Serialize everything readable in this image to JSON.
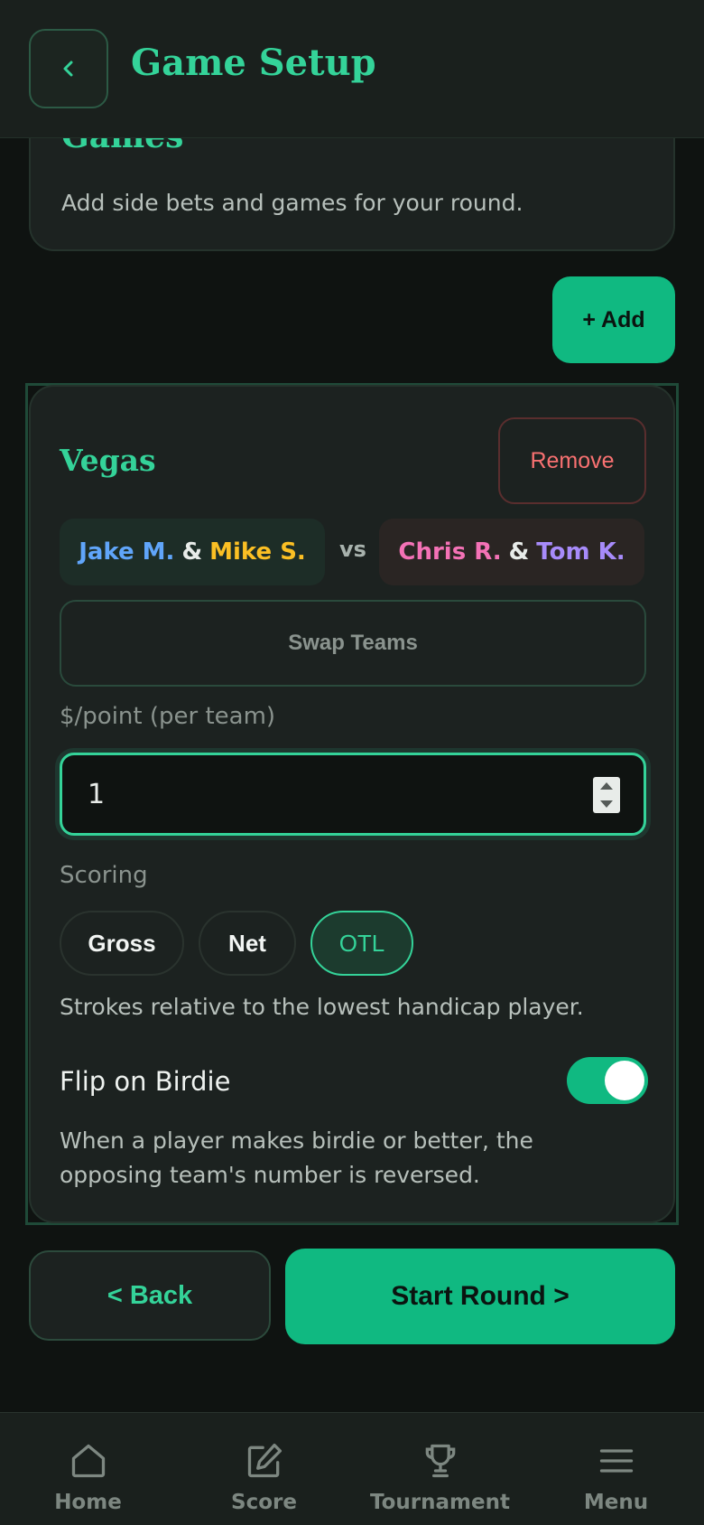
{
  "header": {
    "title": "Game Setup",
    "back_icon": "chevron-left-icon"
  },
  "games_card": {
    "title": "Games",
    "description": "Add side bets and games for your round."
  },
  "add_button": {
    "label": "+ Add"
  },
  "vegas": {
    "title": "Vegas",
    "remove_label": "Remove",
    "team_a": {
      "player1": "Jake M.",
      "player1_color": "#60a5fa",
      "joiner": "&",
      "player2": "Mike S.",
      "player2_color": "#fbbf24"
    },
    "vs_label": "vs",
    "team_b": {
      "player1": "Chris R.",
      "player1_color": "#f472b6",
      "joiner": "&",
      "player2": "Tom K.",
      "player2_color": "#a78bfa"
    },
    "swap_label": "Swap Teams",
    "point_label": "$/point (per team)",
    "point_value": "1",
    "scoring_label": "Scoring",
    "scoring_options": [
      "Gross",
      "Net",
      "OTL"
    ],
    "scoring_selected": "OTL",
    "scoring_description": "Strokes relative to the lowest handicap player.",
    "flip_label": "Flip on Birdie",
    "flip_enabled": true,
    "flip_description": "When a player makes birdie or better, the opposing team's number is reversed."
  },
  "actions": {
    "back_label": "< Back",
    "start_label": "Start Round >"
  },
  "nav": {
    "items": [
      {
        "label": "Home",
        "icon": "home-icon"
      },
      {
        "label": "Score",
        "icon": "edit-icon"
      },
      {
        "label": "Tournament",
        "icon": "trophy-icon"
      },
      {
        "label": "Menu",
        "icon": "menu-icon"
      }
    ]
  },
  "colors": {
    "accent": "#34d399",
    "button": "#10b981",
    "danger": "#f87171",
    "background": "#0f1311",
    "card": "#1c2220"
  }
}
